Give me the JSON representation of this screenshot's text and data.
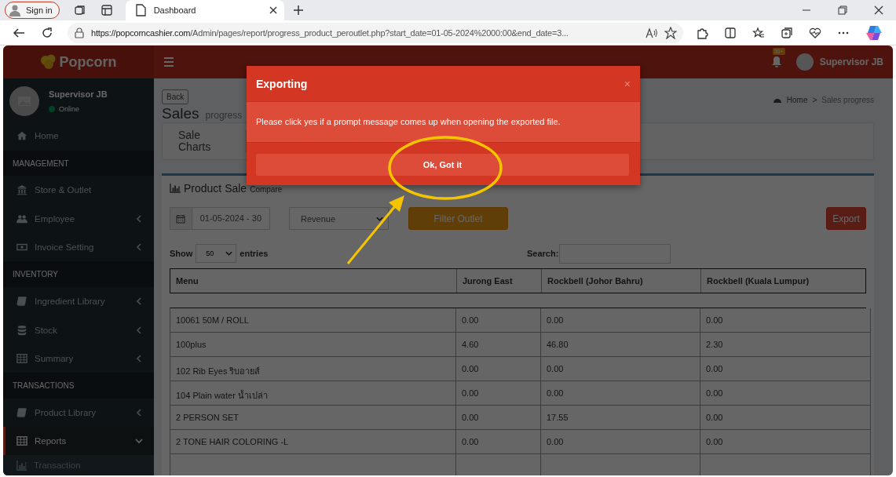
{
  "browser": {
    "sign_in": "Sign in",
    "tab_title": "Dashboard",
    "url_host": "https://popcorncashier.com",
    "url_path": "/Admin/pages/report/progress_product_peroutlet.php?start_date=01-05-2024%2000:00&end_date=3..."
  },
  "header": {
    "logo": "Popcorn",
    "notification_badge": "30+",
    "user": "Supervisor JB"
  },
  "sidebar": {
    "user_name": "Supervisor JB",
    "status": "Online",
    "items": [
      {
        "kind": "link",
        "label": "Home",
        "selected": false
      },
      {
        "kind": "section",
        "label": "MANAGEMENT"
      },
      {
        "kind": "link",
        "label": "Store & Outlet",
        "selected": false
      },
      {
        "kind": "link",
        "label": "Employee",
        "expanded": false,
        "selected": false
      },
      {
        "kind": "link",
        "label": "Invoice Setting",
        "expanded": false,
        "selected": false
      },
      {
        "kind": "section",
        "label": "INVENTORY"
      },
      {
        "kind": "link",
        "label": "Ingredient Library",
        "expanded": false,
        "selected": false
      },
      {
        "kind": "link",
        "label": "Stock",
        "expanded": false,
        "selected": false
      },
      {
        "kind": "link",
        "label": "Summary",
        "expanded": false,
        "selected": false
      },
      {
        "kind": "section",
        "label": "TRANSACTIONS"
      },
      {
        "kind": "link",
        "label": "Product Library",
        "expanded": false,
        "selected": false
      },
      {
        "kind": "link",
        "label": "Reports",
        "expanded": true,
        "selected": true
      },
      {
        "kind": "sublink",
        "label": "Transaction"
      }
    ]
  },
  "page": {
    "back": "Back",
    "title": "Sales",
    "subtitle": "progress",
    "breadcrumb": [
      "Home",
      "Sales progress"
    ],
    "breadcrumb_separator": ">",
    "tab": "Sale Charts",
    "panel_title": "Product Sale",
    "panel_subtitle": "Compare",
    "date_range": "01-05-2024 - 30",
    "metric": "Revenue",
    "filter_button": "Filter Outlet",
    "export_button": "Export",
    "show_label": "Show",
    "page_size": "50",
    "entries_label": "entries",
    "search_label": "Search:",
    "table": {
      "columns": [
        "Menu",
        "Jurong East",
        "Rockbell (Johor Bahru)",
        "Rockbell (Kuala Lumpur)"
      ],
      "rows": [
        [
          "10061 50M / ROLL",
          "0.00",
          "0.00",
          "0.00"
        ],
        [
          "100plus",
          "4.60",
          "46.80",
          "2.30"
        ],
        [
          "102 Rib Eyes ริบอายส์",
          "0.00",
          "0.00",
          "0.00"
        ],
        [
          "104 Plain water น้ำเปล่า",
          "0.00",
          "0.00",
          "0.00"
        ],
        [
          "2 PERSON SET",
          "0.00",
          "17.55",
          "0.00"
        ],
        [
          "2 TONE HAIR COLORING -L",
          "0.00",
          "0.00",
          "0.00"
        ]
      ]
    }
  },
  "modal": {
    "title": "Exporting",
    "close": "×",
    "message": "Please click yes if a prompt message comes up when opening the exported file.",
    "button": "Ok, Got it"
  }
}
